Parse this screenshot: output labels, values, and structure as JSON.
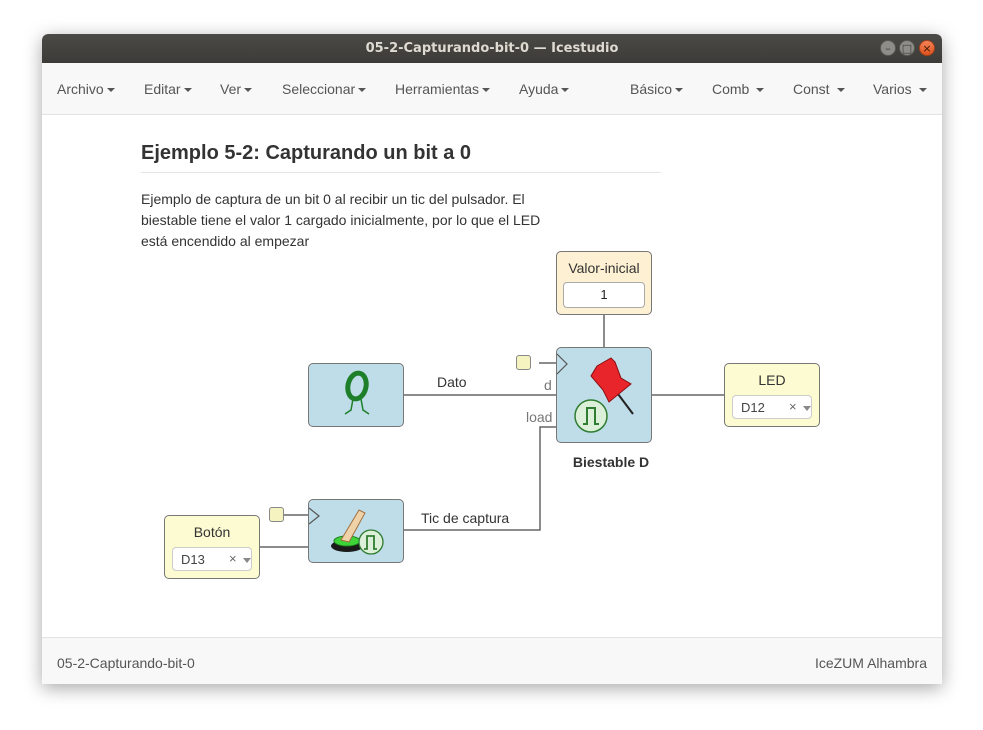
{
  "window": {
    "title": "05-2-Capturando-bit-0 — Icestudio",
    "controls": {
      "minimize": "–",
      "maximize": "□",
      "close": "×"
    }
  },
  "menubar": {
    "left": [
      {
        "label": "Archivo"
      },
      {
        "label": "Editar"
      },
      {
        "label": "Ver"
      },
      {
        "label": "Seleccionar"
      },
      {
        "label": "Herramientas"
      },
      {
        "label": "Ayuda"
      }
    ],
    "right": [
      {
        "label": "Básico"
      },
      {
        "label": "Comb"
      },
      {
        "label": "Const"
      },
      {
        "label": "Varios"
      }
    ]
  },
  "document": {
    "title": "Ejemplo 5-2: Capturando un bit a 0",
    "description": "Ejemplo de captura de un bit 0 al recibir un tic del pulsador. El biestable tiene el valor 1 cargado inicialmente, por lo que el LED está encendido al empezar"
  },
  "circuit": {
    "valor_inicial": {
      "label": "Valor-inicial",
      "value": "1"
    },
    "biestable": {
      "label": "Biestable D",
      "port_d": "d",
      "port_load": "load"
    },
    "led": {
      "label": "LED",
      "pin": "D12",
      "clear": "×"
    },
    "boton": {
      "label": "Botón",
      "pin": "D13",
      "clear": "×"
    },
    "wires": {
      "dato": "Dato",
      "tic": "Tic de captura"
    }
  },
  "footer": {
    "filename": "05-2-Capturando-bit-0",
    "board": "IceZUM Alhambra"
  },
  "colors": {
    "block_blue": "#bfdde8",
    "block_yellow": "#fdfbd1",
    "block_beige": "#fdf0d3",
    "close_button": "#e95420"
  }
}
